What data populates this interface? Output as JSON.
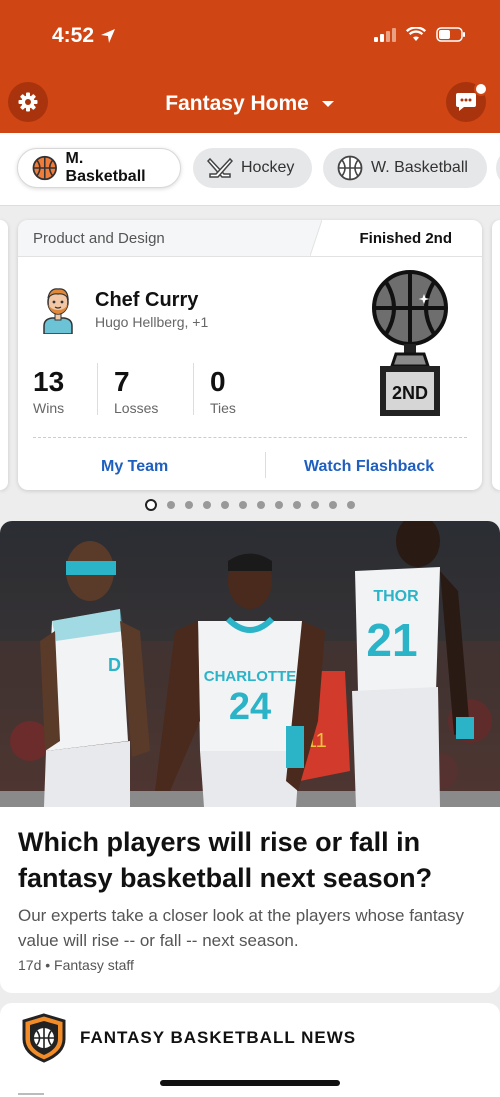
{
  "status": {
    "time": "4:52"
  },
  "header": {
    "title": "Fantasy Home"
  },
  "sports": [
    {
      "label": "M. Basketball",
      "icon": "basketball-icon"
    },
    {
      "label": "Hockey",
      "icon": "hockey-sticks-icon"
    },
    {
      "label": "W. Basketball",
      "icon": "basketball-icon"
    }
  ],
  "league_card": {
    "league_name": "Product and Design",
    "finish": "Finished 2nd",
    "team_name": "Chef Curry",
    "owners": "Hugo Hellberg, +1",
    "stats": [
      {
        "value": "13",
        "label": "Wins"
      },
      {
        "value": "7",
        "label": "Losses"
      },
      {
        "value": "0",
        "label": "Ties"
      }
    ],
    "trophy_label": "2ND",
    "links": {
      "my_team": "My Team",
      "watch_flashback": "Watch Flashback"
    }
  },
  "carousel": {
    "total": 12,
    "active": 0
  },
  "article": {
    "title": "Which players will rise or fall in fantasy basketball next season?",
    "subtitle": "Our experts take a closer look at the players whose fantasy value will rise -- or fall -- next season.",
    "meta": "17d • Fantasy staff",
    "photo": {
      "team_text": "CHARLOTTE",
      "center_number": "24",
      "right_name": "THOR",
      "right_number": "21",
      "left_partial": "D"
    }
  },
  "news_section": {
    "title": "FANTASY BASKETBALL NEWS"
  },
  "colors": {
    "brand": "#cf4514",
    "link": "#1f5fbf",
    "jersey_teal": "#2bb3c8"
  }
}
